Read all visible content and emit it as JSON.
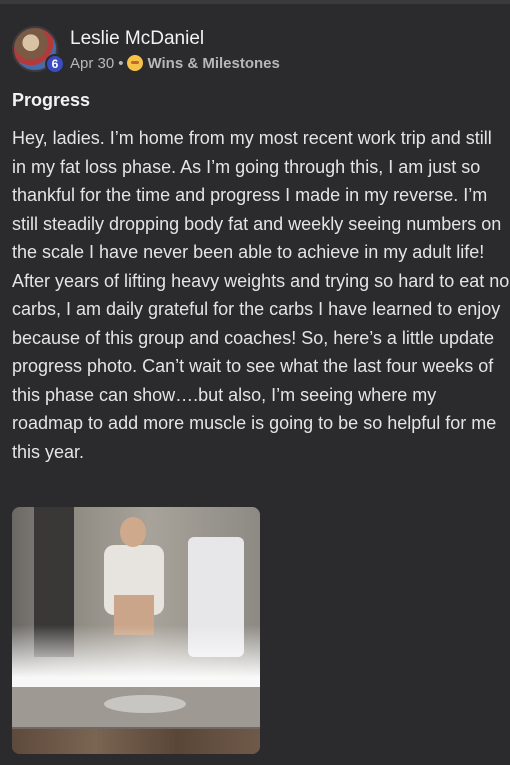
{
  "post": {
    "author": "Leslie McDaniel",
    "badge_count": "6",
    "date": "Apr 30",
    "separator": "•",
    "category_icon": "smiling-emoji-icon",
    "category": "Wins & Milestones",
    "title": "Progress",
    "body": "Hey, ladies. I’m home from my most recent work trip and still in my fat loss phase. As I’m going through this, I am just so thankful for the time and progress I made in my reverse. I’m still steadily dropping body fat and weekly seeing numbers on the scale I have never been able to achieve in my adult life! After years of lifting heavy weights and trying so hard to eat no carbs, I am daily grateful for the carbs I have learned to enjoy because of this group and coaches! So, here’s a little update progress photo. Can’t wait to see what the last four weeks of this phase can show….but also, I’m seeing where my roadmap to add more muscle is going to be so helpful for me this year."
  },
  "colors": {
    "background": "#2b2b2d",
    "text": "#e4e4e6",
    "meta": "#b7b7ba",
    "badge": "#3b4cc0"
  }
}
